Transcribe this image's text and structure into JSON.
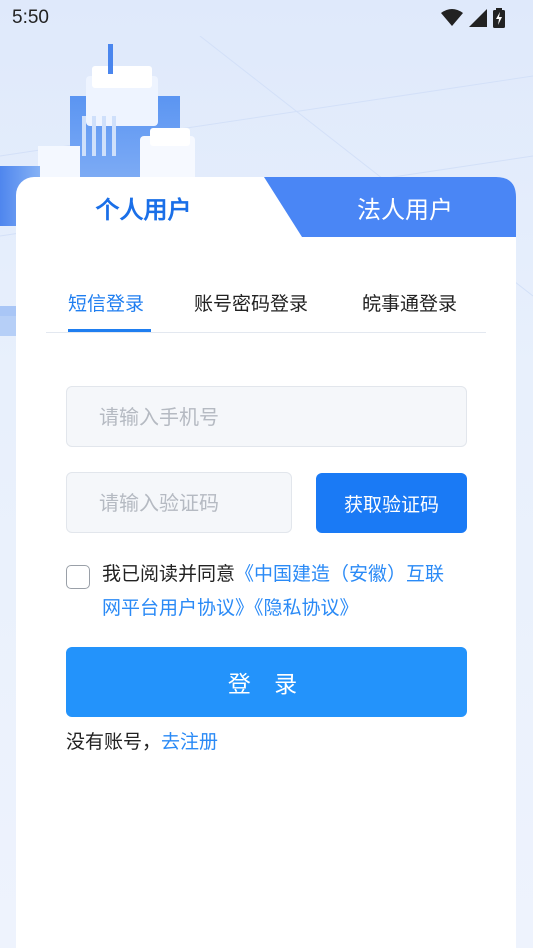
{
  "status_bar": {
    "time": "5:50",
    "icons": [
      "wifi-icon",
      "cell-signal-icon",
      "battery-charging-icon"
    ]
  },
  "user_tabs": {
    "personal": "个人用户",
    "legal": "法人用户",
    "active": "personal"
  },
  "login_tabs": {
    "items": [
      "短信登录",
      "账号密码登录",
      "皖事通登录"
    ],
    "active_index": 0
  },
  "form": {
    "phone_placeholder": "请输入手机号",
    "phone_value": "",
    "code_placeholder": "请输入验证码",
    "code_value": "",
    "get_code_label": "获取验证码"
  },
  "agreement": {
    "checked": false,
    "prefix": "我已阅读并同意",
    "link1": "《中国建造（安徽）互联网平台用户协议》",
    "link2": "《隐私协议》"
  },
  "login_button": "登 录",
  "register": {
    "prompt": "没有账号，",
    "link": "去注册"
  },
  "colors": {
    "accent": "#1a7af5",
    "link": "#2a8af6",
    "login_button": "#2393fb",
    "legal_tab": "#4a86f5"
  }
}
